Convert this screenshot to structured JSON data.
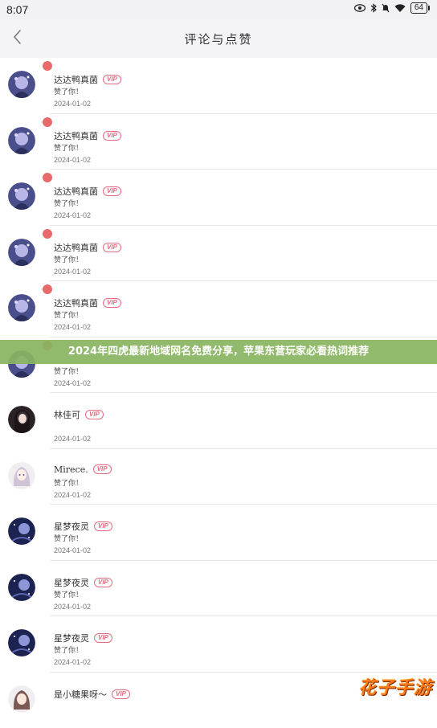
{
  "status_bar": {
    "time": "8:07",
    "battery": "64",
    "icons": [
      "eye-icon",
      "bluetooth-icon",
      "mute-icon",
      "wifi-icon",
      "battery-icon"
    ]
  },
  "header": {
    "title": "评论与点赞",
    "back_icon": "chevron-left-icon"
  },
  "rows": [
    {
      "name": "达达鸭真菌",
      "vip": "VIP",
      "action": "赞了你！",
      "date": "2024-01-02",
      "unread": true,
      "avatar": "anime-purple"
    },
    {
      "name": "达达鸭真菌",
      "vip": "VIP",
      "action": "赞了你！",
      "date": "2024-01-02",
      "unread": true,
      "avatar": "anime-purple"
    },
    {
      "name": "达达鸭真菌",
      "vip": "VIP",
      "action": "赞了你！",
      "date": "2024-01-02",
      "unread": true,
      "avatar": "anime-purple"
    },
    {
      "name": "达达鸭真菌",
      "vip": "VIP",
      "action": "赞了你！",
      "date": "2024-01-02",
      "unread": true,
      "avatar": "anime-purple"
    },
    {
      "name": "达达鸭真菌",
      "vip": "VIP",
      "action": "赞了你！",
      "date": "2024-01-02",
      "unread": true,
      "avatar": "anime-purple"
    },
    {
      "name": "",
      "vip": "",
      "action": "赞了你！",
      "date": "2024-01-02",
      "unread": true,
      "avatar": "anime-purple"
    },
    {
      "name": "林佳可",
      "vip": "VIP",
      "action": "",
      "date": "2024-01-02",
      "unread": false,
      "avatar": "dark-girl"
    },
    {
      "name": "Mirece.",
      "vip": "VIP",
      "action": "赞了你！",
      "date": "2024-01-02",
      "unread": false,
      "avatar": "light-girl"
    },
    {
      "name": "星梦夜灵",
      "vip": "VIP",
      "action": "赞了你！",
      "date": "2024-01-02",
      "unread": false,
      "avatar": "night-sky"
    },
    {
      "name": "星梦夜灵",
      "vip": "VIP",
      "action": "赞了你！",
      "date": "2024-01-02",
      "unread": false,
      "avatar": "night-sky"
    },
    {
      "name": "星梦夜灵",
      "vip": "VIP",
      "action": "赞了你！",
      "date": "2024-01-02",
      "unread": false,
      "avatar": "night-sky"
    },
    {
      "name": "是小糖果呀～",
      "vip": "VIP",
      "action": "",
      "date": "",
      "unread": false,
      "avatar": "light-girl"
    }
  ],
  "banner": {
    "text": "2024年四虎最新地域网名免费分享，苹果东营玩家必看热词推荐"
  },
  "watermark": {
    "text": "花子手游"
  },
  "colors": {
    "unread_dot": "#e86a6a",
    "vip": "#e56b80",
    "banner_bg": "#89b461",
    "watermark": "#ff7a1a"
  }
}
